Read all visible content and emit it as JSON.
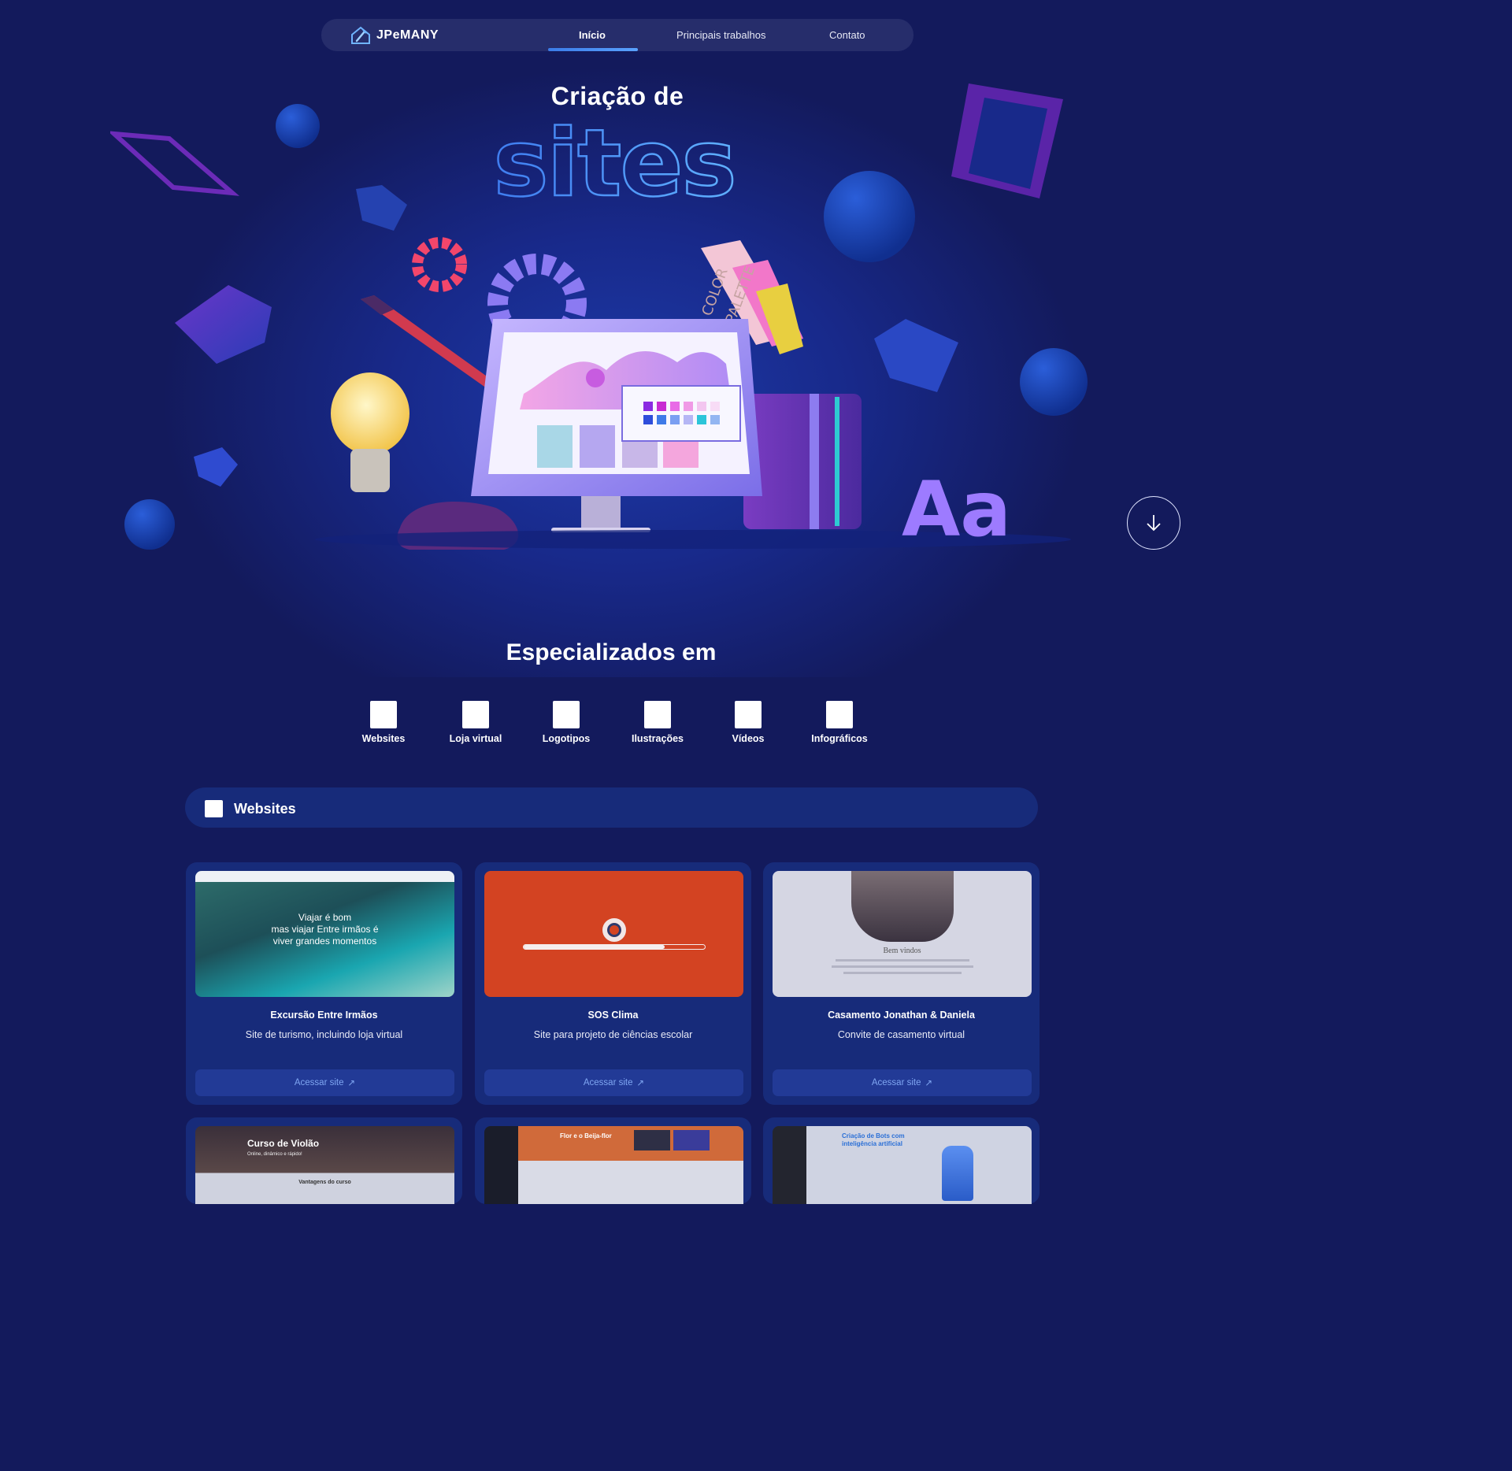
{
  "brand": {
    "name": "JPeMANY"
  },
  "nav": {
    "items": [
      {
        "label": "Início",
        "active": true
      },
      {
        "label": "Principais trabalhos",
        "active": false
      },
      {
        "label": "Contato",
        "active": false
      }
    ]
  },
  "hero": {
    "title": "Criação de",
    "highlight": "sites",
    "illustration": {
      "palette_label_1": "COLOR",
      "palette_label_2": "PALETTE",
      "typography_label": "Aa"
    },
    "scroll_icon": "arrow-down-icon"
  },
  "specialized": {
    "title": "Especializados em",
    "items": [
      {
        "label": "Websites"
      },
      {
        "label": "Loja virtual"
      },
      {
        "label": "Logotipos"
      },
      {
        "label": "Ilustrações"
      },
      {
        "label": "Vídeos"
      },
      {
        "label": "Infográficos"
      }
    ]
  },
  "section": {
    "title": "Websites"
  },
  "projects": [
    {
      "title": "Excursão Entre Irmãos",
      "description": "Site de turismo, incluindo loja virtual",
      "button": "Acessar site",
      "thumb_text": [
        "Viajar é bom",
        "mas viajar Entre irmãos é",
        "viver grandes momentos"
      ]
    },
    {
      "title": "SOS Clima",
      "description": "Site para projeto de ciências escolar",
      "button": "Acessar site",
      "thumb_progress": 0.78
    },
    {
      "title": "Casamento Jonathan & Daniela",
      "description": "Convite de casamento virtual",
      "button": "Acessar site",
      "thumb_text": [
        "Bem vindos"
      ]
    },
    {
      "thumb_text": [
        "Curso de Violão",
        "Online, dinâmico e rápido!",
        "Vantagens do curso"
      ]
    },
    {
      "thumb_text": [
        "Flor e o Beija-flor"
      ]
    },
    {
      "thumb_text": [
        "Criação de Bots com",
        "inteligência artificial"
      ]
    }
  ],
  "colors": {
    "background": "#131a5c",
    "card": "#172b7a",
    "button": "#223a96",
    "link": "#7fa6f2",
    "accent": "#3b7ce8"
  }
}
